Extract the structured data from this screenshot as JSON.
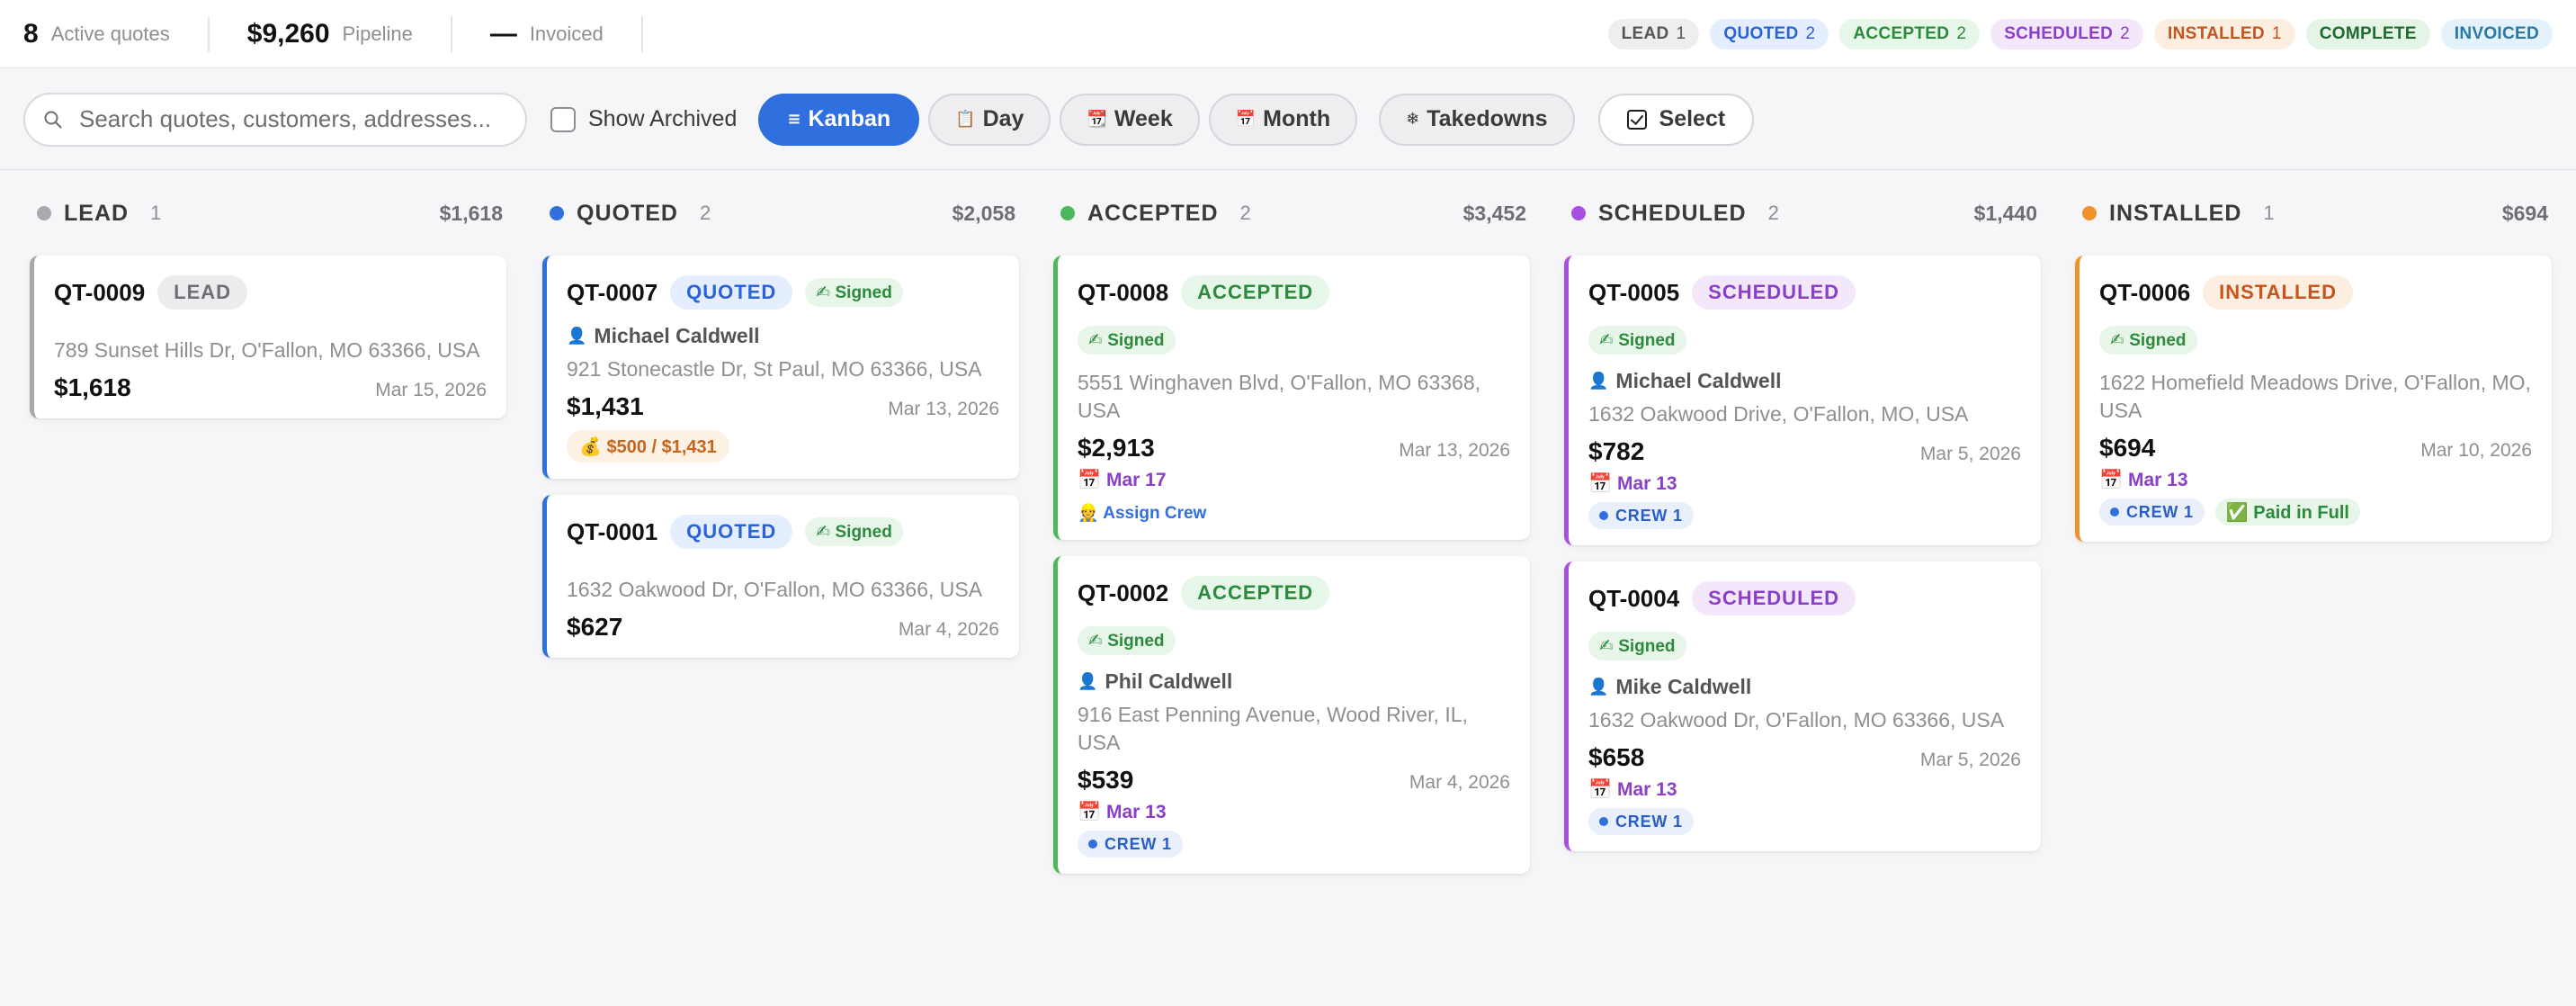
{
  "stats": [
    {
      "value": "8",
      "label": "Active quotes"
    },
    {
      "value": "$9,260",
      "label": "Pipeline"
    },
    {
      "value": "—",
      "label": "Invoiced"
    }
  ],
  "status_badges": [
    {
      "label": "LEAD",
      "count": "1",
      "bg": "#eeeeef",
      "fg": "#555555"
    },
    {
      "label": "QUOTED",
      "count": "2",
      "bg": "#e4eeff",
      "fg": "#2a62d8"
    },
    {
      "label": "ACCEPTED",
      "count": "2",
      "bg": "#e6f6e8",
      "fg": "#2c8a3d"
    },
    {
      "label": "SCHEDULED",
      "count": "2",
      "bg": "#f3e8fb",
      "fg": "#8b3fc8"
    },
    {
      "label": "INSTALLED",
      "count": "1",
      "bg": "#fdeee2",
      "fg": "#c8541b"
    },
    {
      "label": "COMPLETE",
      "count": "",
      "bg": "#e4f4e6",
      "fg": "#1f6b2e"
    },
    {
      "label": "INVOICED",
      "count": "",
      "bg": "#e3f2fb",
      "fg": "#2978a8"
    }
  ],
  "toolbar": {
    "search_placeholder": "Search quotes, customers, addresses...",
    "show_archived_label": "Show Archived",
    "views": [
      {
        "icon": "≡",
        "label": "Kanban",
        "active": true
      },
      {
        "icon": "📋",
        "label": "Day",
        "active": false
      },
      {
        "icon": "📆",
        "label": "Week",
        "active": false
      },
      {
        "icon": "📅",
        "label": "Month",
        "active": false
      }
    ],
    "takedowns_icon": "❄",
    "takedowns_label": "Takedowns",
    "select_label": "Select"
  },
  "columns": [
    {
      "title": "LEAD",
      "count": "1",
      "total": "$1,618",
      "color": "#a8a8ad",
      "tag_bg": "#ececee",
      "tag_fg": "#6e6e73",
      "cards": [
        {
          "id": "QT-0009",
          "tag": "LEAD",
          "address": "789 Sunset Hills Dr, O'Fallon, MO 63366, USA",
          "amount": "$1,618",
          "date": "Mar 15, 2026"
        }
      ]
    },
    {
      "title": "QUOTED",
      "count": "2",
      "total": "$2,058",
      "color": "#2f6fde",
      "tag_bg": "#e4eeff",
      "tag_fg": "#2a62d8",
      "cards": [
        {
          "id": "QT-0007",
          "tag": "QUOTED",
          "signed": "✍ Signed",
          "signed_inline": true,
          "customer": "Michael Caldwell",
          "address": "921 Stonecastle Dr, St Paul, MO 63366, USA",
          "amount": "$1,431",
          "date": "Mar 13, 2026",
          "deposit": "💰 $500 / $1,431"
        },
        {
          "id": "QT-0001",
          "tag": "QUOTED",
          "signed": "✍ Signed",
          "signed_inline": true,
          "address": "1632 Oakwood Dr, O'Fallon, MO 63366, USA",
          "amount": "$627",
          "date": "Mar 4, 2026"
        }
      ]
    },
    {
      "title": "ACCEPTED",
      "count": "2",
      "total": "$3,452",
      "color": "#4cb85a",
      "tag_bg": "#e6f6e8",
      "tag_fg": "#2c8a3d",
      "cards": [
        {
          "id": "QT-0008",
          "tag": "ACCEPTED",
          "signed": "✍ Signed",
          "address": "5551 Winghaven Blvd, O'Fallon, MO 63368, USA",
          "amount": "$2,913",
          "date": "Mar 13, 2026",
          "schedule": "📅 Mar 17",
          "assign": "👷 Assign Crew"
        },
        {
          "id": "QT-0002",
          "tag": "ACCEPTED",
          "signed": "✍ Signed",
          "customer": "Phil Caldwell",
          "address": "916 East Penning Avenue, Wood River, IL, USA",
          "amount": "$539",
          "date": "Mar 4, 2026",
          "schedule": "📅 Mar 13",
          "crew": "CREW 1"
        }
      ]
    },
    {
      "title": "SCHEDULED",
      "count": "2",
      "total": "$1,440",
      "color": "#a64fe0",
      "tag_bg": "#f3e8fb",
      "tag_fg": "#8b3fc8",
      "cards": [
        {
          "id": "QT-0005",
          "tag": "SCHEDULED",
          "signed": "✍ Signed",
          "customer": "Michael Caldwell",
          "address": "1632 Oakwood Drive, O'Fallon, MO, USA",
          "amount": "$782",
          "date": "Mar 5, 2026",
          "schedule": "📅 Mar 13",
          "crew": "CREW 1"
        },
        {
          "id": "QT-0004",
          "tag": "SCHEDULED",
          "signed": "✍ Signed",
          "customer": "Mike Caldwell",
          "address": "1632 Oakwood Dr, O'Fallon, MO 63366, USA",
          "amount": "$658",
          "date": "Mar 5, 2026",
          "schedule": "📅 Mar 13",
          "crew": "CREW 1"
        }
      ]
    },
    {
      "title": "INSTALLED",
      "count": "1",
      "total": "$694",
      "color": "#f0922c",
      "tag_bg": "#fdeee2",
      "tag_fg": "#c8541b",
      "cards": [
        {
          "id": "QT-0006",
          "tag": "INSTALLED",
          "signed": "✍ Signed",
          "address": "1622 Homefield Meadows Drive, O'Fallon, MO, USA",
          "amount": "$694",
          "date": "Mar 10, 2026",
          "schedule": "📅 Mar 13",
          "crew": "CREW 1",
          "paid": "✅ Paid in Full"
        }
      ]
    }
  ]
}
